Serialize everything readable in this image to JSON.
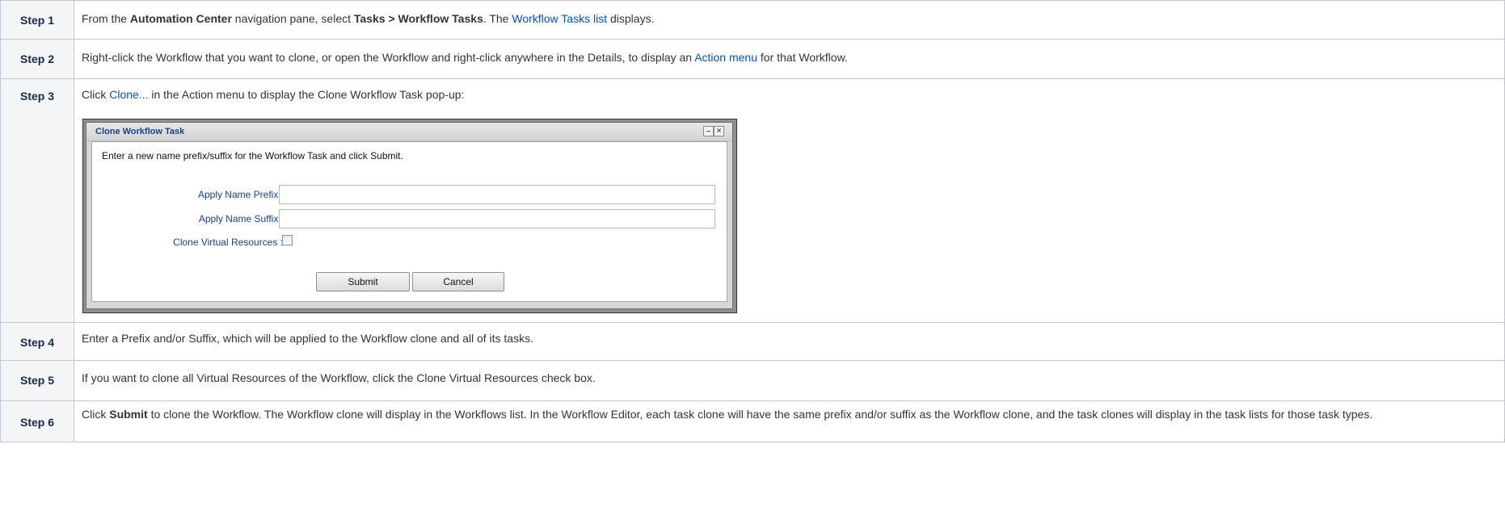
{
  "steps": [
    {
      "label": "Step 1",
      "parts": [
        {
          "t": "From the ",
          "k": "text"
        },
        {
          "t": "Automation Center",
          "k": "bold"
        },
        {
          "t": " navigation pane, select ",
          "k": "text"
        },
        {
          "t": "Tasks > Workflow Tasks",
          "k": "bold"
        },
        {
          "t": ". The ",
          "k": "text"
        },
        {
          "t": "Workflow Tasks list",
          "k": "link"
        },
        {
          "t": " displays.",
          "k": "text"
        }
      ]
    },
    {
      "label": "Step 2",
      "parts": [
        {
          "t": "Right-click the Workflow that you want to clone, or open the Workflow and right-click anywhere in the Details, to display an ",
          "k": "text"
        },
        {
          "t": "Action menu",
          "k": "link"
        },
        {
          "t": " for that Workflow.",
          "k": "text"
        }
      ]
    },
    {
      "label": "Step 3",
      "parts": [
        {
          "t": "Click ",
          "k": "text"
        },
        {
          "t": "Clone...",
          "k": "link"
        },
        {
          "t": " in the Action menu to display the Clone Workflow Task pop-up:",
          "k": "text"
        }
      ]
    },
    {
      "label": "Step 4",
      "parts": [
        {
          "t": "Enter a Prefix and/or Suffix, which will be applied to the Workflow clone and all of its tasks.",
          "k": "text"
        }
      ]
    },
    {
      "label": "Step 5",
      "parts": [
        {
          "t": "If you want to clone all Virtual Resources of the Workflow, click the Clone Virtual Resources check box.",
          "k": "text"
        }
      ]
    },
    {
      "label": "Step 6",
      "parts": [
        {
          "t": "Click ",
          "k": "text"
        },
        {
          "t": "Submit",
          "k": "bold"
        },
        {
          "t": " to clone the Workflow. The Workflow clone will display in the Workflows list. In the Workflow Editor, each task clone will have the same prefix and/or suffix as the Workflow clone, and the task clones will display in the task lists for those task types.",
          "k": "text"
        }
      ]
    }
  ],
  "dialog": {
    "title": "Clone Workflow Task",
    "message": "Enter a new name prefix/suffix for the Workflow Task and click Submit.",
    "prefix_label": "Apply Name Prefix :",
    "prefix_value": "",
    "suffix_label": "Apply Name Suffix :",
    "suffix_value": "",
    "virtual_label": "Clone Virtual Resources :",
    "virtual_checked": false,
    "submit_label": "Submit",
    "cancel_label": "Cancel",
    "minimize_glyph": "–",
    "close_glyph": "×"
  },
  "colors": {
    "link": "#0052cc",
    "label_blue": "#15428b",
    "step_bg": "#f4f5f7"
  }
}
